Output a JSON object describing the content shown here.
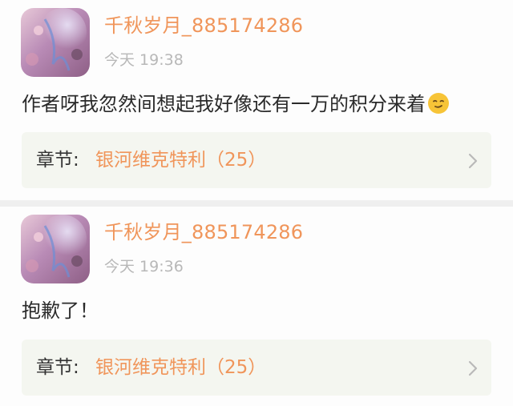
{
  "comments": [
    {
      "username": "千秋岁月_885174286",
      "time": "今天 19:38",
      "text": "作者呀我忽然间想起我好像还有一万的积分来着",
      "emoji": "smiling-face-emoji",
      "chapter_label": "章节:",
      "chapter_title": "银河维克特利（25）"
    },
    {
      "username": "千秋岁月_885174286",
      "time": "今天 19:36",
      "text": "抱歉了！",
      "chapter_label": "章节:",
      "chapter_title": "银河维克特利（25）"
    }
  ],
  "colors": {
    "accent": "#f0955a",
    "card_bg": "#f4f6f0",
    "muted": "#b8b8b8",
    "text": "#2a2a2a"
  },
  "icons": {
    "chevron": "chevron-right-icon",
    "avatar": "avatar"
  }
}
